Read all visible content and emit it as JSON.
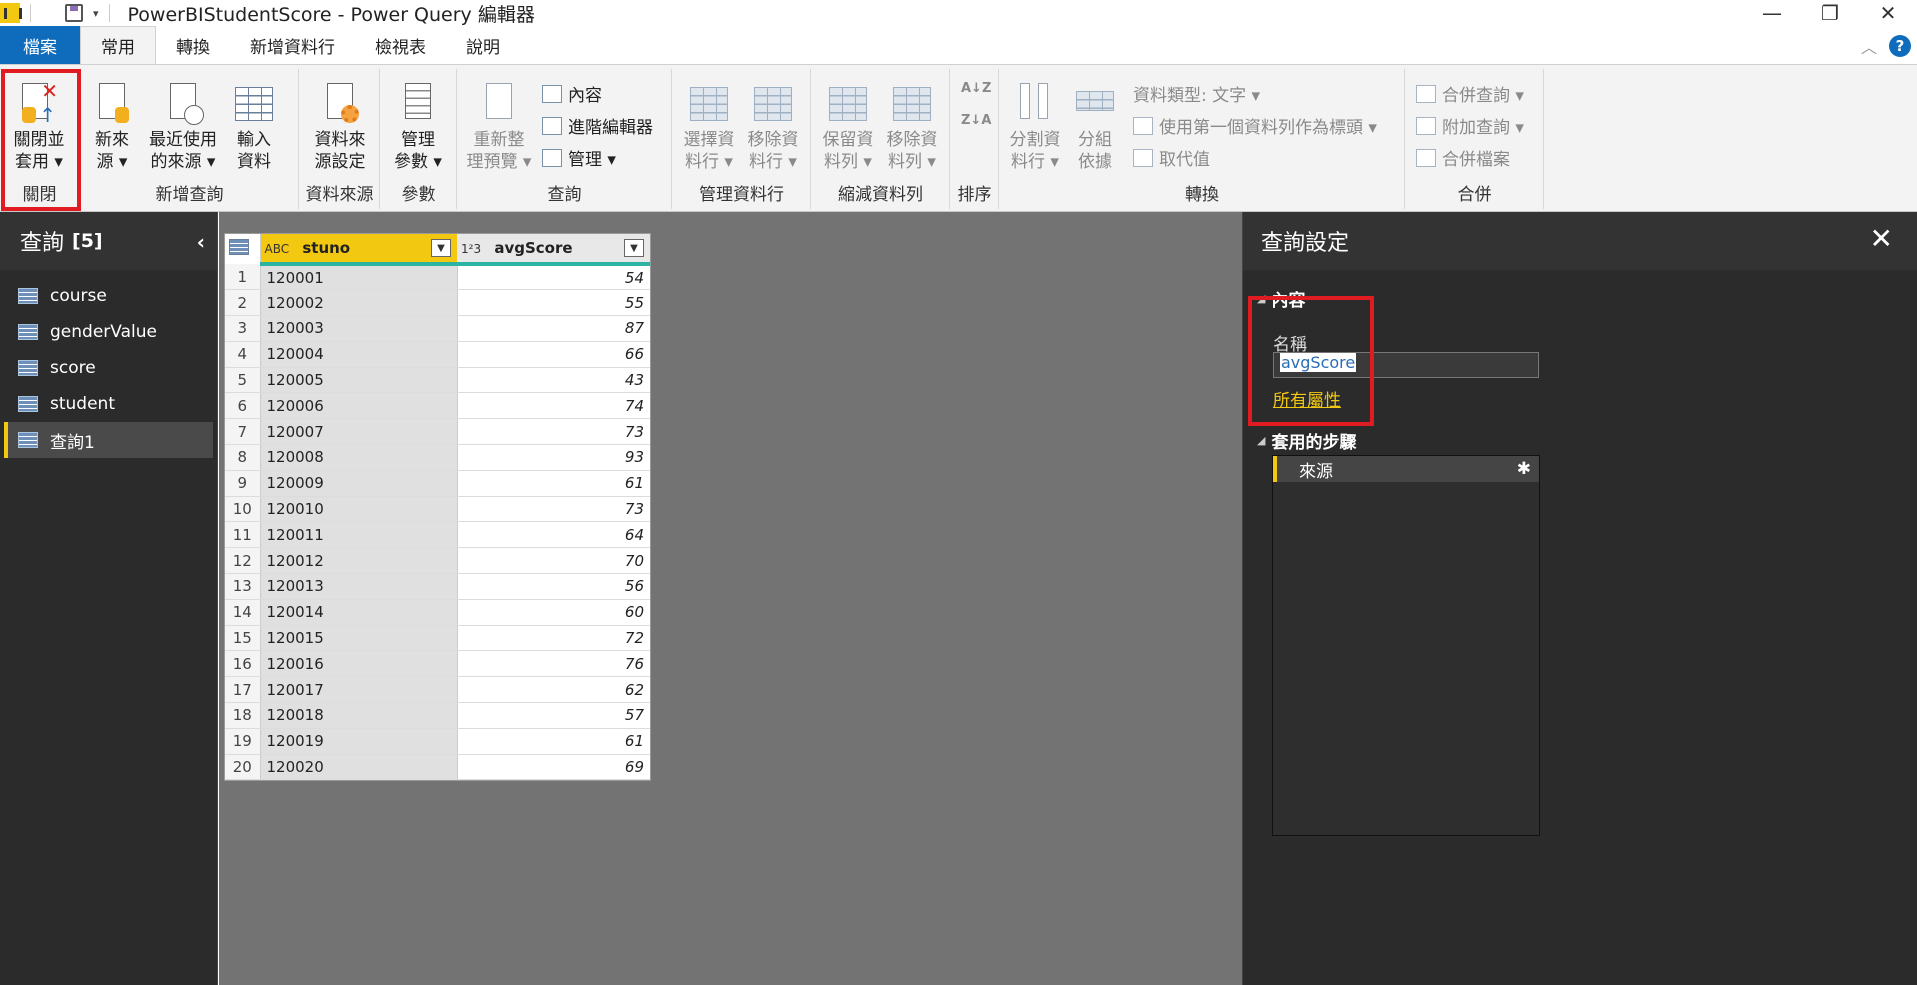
{
  "window": {
    "title": "PowerBIStudentScore - Power Query 編輯器",
    "qa_dropdown": "▾",
    "minimize": "—",
    "restore": "❐",
    "close": "✕"
  },
  "menu": {
    "tabs": [
      {
        "label": "檔案"
      },
      {
        "label": "常用"
      },
      {
        "label": "轉換"
      },
      {
        "label": "新增資料行"
      },
      {
        "label": "檢視表"
      },
      {
        "label": "說明"
      }
    ],
    "collapse_ribbon": "︿",
    "help": "?"
  },
  "ribbon": {
    "close_group": {
      "label": "關閉",
      "close_apply": "關閉並\n套用 ▾"
    },
    "new_query_group": {
      "label": "新增查詢",
      "new_source": "新來\n源 ▾",
      "recent_sources": "最近使用\n的來源 ▾",
      "enter_data": "輸入\n資料"
    },
    "data_source_group": {
      "label": "資料來源",
      "source_settings": "資料來\n源設定"
    },
    "params_group": {
      "label": "參數",
      "manage_params": "管理\n參數 ▾"
    },
    "query_group": {
      "label": "查詢",
      "refresh_preview": "重新整\n理預覽 ▾",
      "properties": "內容",
      "advanced_editor": "進階編輯器",
      "manage": "管理 ▾"
    },
    "manage_columns_group": {
      "label": "管理資料行",
      "choose_columns": "選擇資\n料行 ▾",
      "remove_columns": "移除資\n料行 ▾"
    },
    "reduce_rows_group": {
      "label": "縮減資料列",
      "keep_rows": "保留資\n料列 ▾",
      "remove_rows": "移除資\n料列 ▾"
    },
    "sort_group": {
      "label": "排序",
      "sort_asc": "A↓Z",
      "sort_desc": "Z↓A"
    },
    "transform_group": {
      "label": "轉換",
      "split_column": "分割資\n料行 ▾",
      "group_by": "分組\n依據",
      "data_type": "資料類型: 文字 ▾",
      "use_first_row": "使用第一個資料列作為標頭 ▾",
      "replace_values": "取代值"
    },
    "combine_group": {
      "label": "合併",
      "merge_queries": "合併查詢 ▾",
      "append_queries": "附加查詢 ▾",
      "combine_files": "合併檔案"
    }
  },
  "queries_pane": {
    "title": "查詢",
    "count": "[5]",
    "collapse": "‹",
    "items": [
      {
        "label": "course"
      },
      {
        "label": "genderValue"
      },
      {
        "label": "score"
      },
      {
        "label": "student"
      },
      {
        "label": "查詢1"
      }
    ]
  },
  "table": {
    "columns": [
      {
        "type": "ABC",
        "name": "stuno"
      },
      {
        "type": "1²3",
        "name": "avgScore"
      }
    ],
    "rows": [
      [
        "1",
        "120001",
        "54"
      ],
      [
        "2",
        "120002",
        "55"
      ],
      [
        "3",
        "120003",
        "87"
      ],
      [
        "4",
        "120004",
        "66"
      ],
      [
        "5",
        "120005",
        "43"
      ],
      [
        "6",
        "120006",
        "74"
      ],
      [
        "7",
        "120007",
        "73"
      ],
      [
        "8",
        "120008",
        "93"
      ],
      [
        "9",
        "120009",
        "61"
      ],
      [
        "10",
        "120010",
        "73"
      ],
      [
        "11",
        "120011",
        "64"
      ],
      [
        "12",
        "120012",
        "70"
      ],
      [
        "13",
        "120013",
        "56"
      ],
      [
        "14",
        "120014",
        "60"
      ],
      [
        "15",
        "120015",
        "72"
      ],
      [
        "16",
        "120016",
        "76"
      ],
      [
        "17",
        "120017",
        "62"
      ],
      [
        "18",
        "120018",
        "57"
      ],
      [
        "19",
        "120019",
        "61"
      ],
      [
        "20",
        "120020",
        "69"
      ]
    ]
  },
  "settings_pane": {
    "title": "查詢設定",
    "close": "✕",
    "properties_section": "內容",
    "name_label": "名稱",
    "name_value": "avgScore",
    "all_properties": "所有屬性",
    "steps_section": "套用的步驟",
    "steps": [
      {
        "label": "來源"
      }
    ],
    "step_gear": "✱"
  }
}
